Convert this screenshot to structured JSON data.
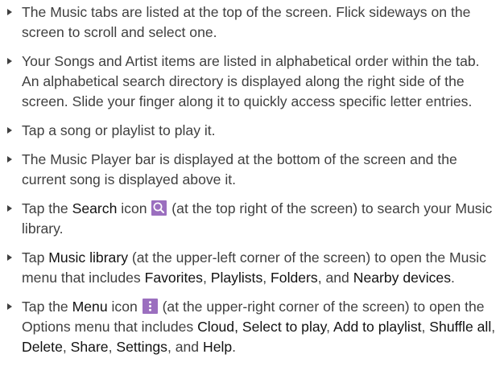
{
  "accent_color": "#9b6fbf",
  "bullets": [
    {
      "text": "The Music tabs are listed at the top of the screen. Flick sideways on the screen to scroll and select one."
    },
    {
      "text": "Your Songs and Artist items are listed in alphabetical order within the tab. An alphabetical search directory is displayed along the right side of the screen. Slide your finger along it to quickly access specific letter entries."
    },
    {
      "text": "Tap a song or playlist to play it."
    },
    {
      "text": "The Music Player bar is displayed at the bottom of the screen and the current song is displayed above it."
    },
    {
      "pre": "Tap the ",
      "term": "Search",
      "mid": " icon ",
      "icon": "search-icon",
      "post": " (at the top right of the screen) to search your Music library."
    },
    {
      "pre": "Tap ",
      "term": "Music library",
      "mid": " (at the upper-left corner of the screen) to open the Music menu that includes ",
      "t1": "Favorites",
      "s1": ", ",
      "t2": "Playlists",
      "s2": ", ",
      "t3": "Folders",
      "s3": ", and ",
      "t4": "Nearby devices",
      "post": "."
    },
    {
      "pre": "Tap the ",
      "term": "Menu",
      "mid": " icon ",
      "icon": "menu-icon",
      "post": " (at the upper-right corner of the screen) to open the Options menu that includes ",
      "t1": "Cloud, Select to play",
      "s1": ", ",
      "t2": "Add to playlist",
      "s2": ", ",
      "t3": "Shuffle all",
      "s3": ", ",
      "t4": "Delete",
      "s4": ", ",
      "t5": "Share",
      "s5": ", ",
      "t6": "Settings",
      "s6": ", and ",
      "t7": "Help",
      "end": "."
    }
  ]
}
